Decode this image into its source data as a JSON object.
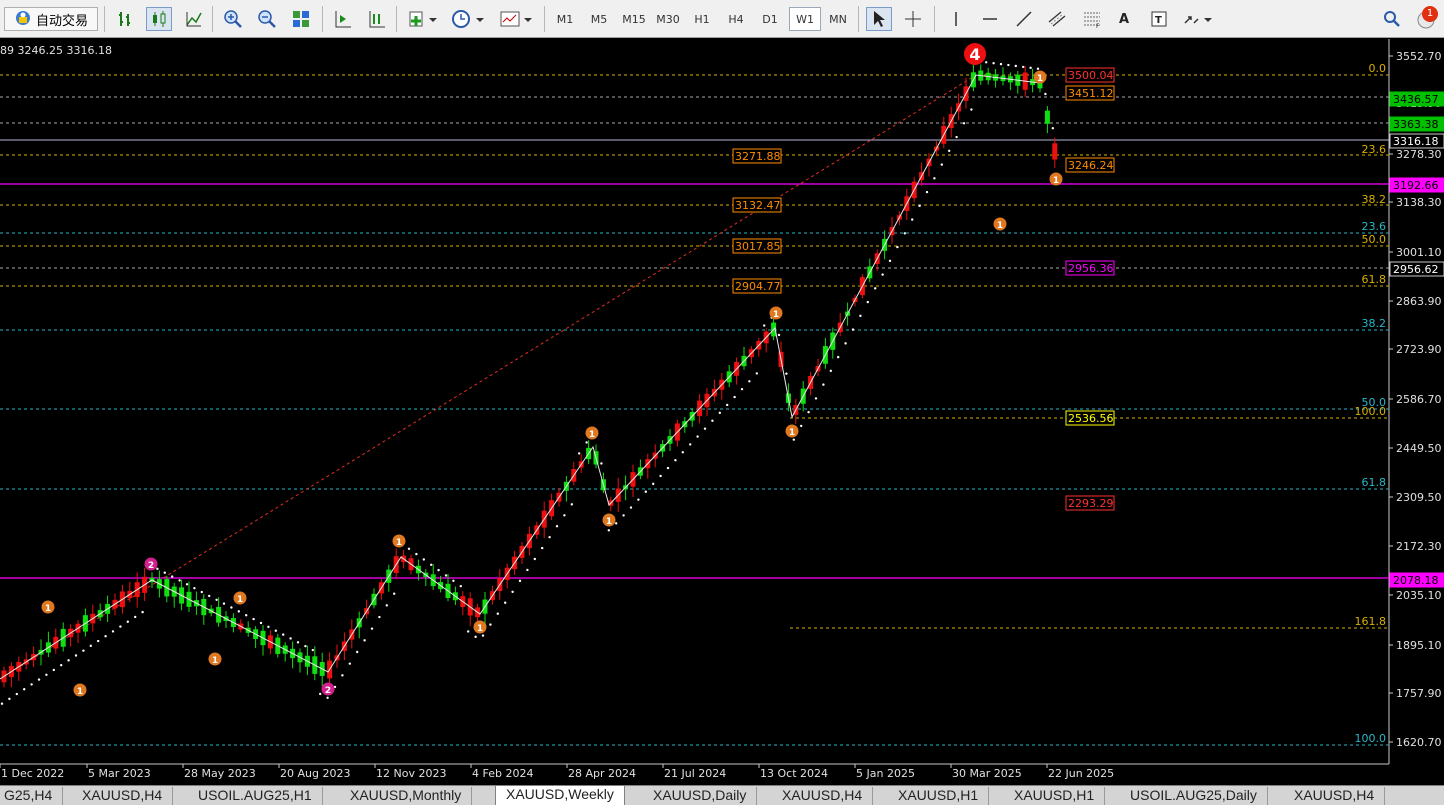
{
  "toolbar": {
    "autotrade_label": "自动交易",
    "timeframes": [
      "M1",
      "M5",
      "M15",
      "M30",
      "H1",
      "H4",
      "D1",
      "W1",
      "MN"
    ],
    "active_timeframe": "W1",
    "text_tool_label": "A"
  },
  "notification_count": "1",
  "chart": {
    "info": "89 3246.25 3316.18",
    "price_axis": [
      "3552.70",
      "3415.90",
      "3278.30",
      "3138.30",
      "3001.10",
      "2863.90",
      "2723.90",
      "2586.70",
      "2449.50",
      "2309.50",
      "2172.30",
      "2035.10",
      "1895.10",
      "1757.90",
      "1620.70"
    ],
    "price_tags": [
      {
        "text": "3436.57",
        "bg": "#00c000",
        "fg": "#000"
      },
      {
        "text": "3363.38",
        "bg": "#00c000",
        "fg": "#000"
      },
      {
        "text": "3316.18",
        "bg": "#000",
        "fg": "#fff"
      },
      {
        "text": "3192.66",
        "bg": "#ff00ff",
        "fg": "#000"
      },
      {
        "text": "2956.62",
        "bg": "#000",
        "fg": "#fff"
      },
      {
        "text": "2078.18",
        "bg": "#ff00ff",
        "fg": "#000"
      }
    ],
    "time_axis": [
      "1 Dec 2022",
      "5 Mar 2023",
      "28 May 2023",
      "20 Aug 2023",
      "12 Nov 2023",
      "4 Feb 2024",
      "28 Apr 2024",
      "21 Jul 2024",
      "13 Oct 2024",
      "5 Jan 2025",
      "30 Mar 2025",
      "22 Jun 2025"
    ],
    "fib_labels": [
      {
        "text": "0.0",
        "color": "#d8b000"
      },
      {
        "text": "23.6",
        "color": "#d8b000"
      },
      {
        "text": "38.2",
        "color": "#d8b000"
      },
      {
        "text": "23.6",
        "color": "#29b6c8"
      },
      {
        "text": "50.0",
        "color": "#d8b000"
      },
      {
        "text": "61.8",
        "color": "#d8b000"
      },
      {
        "text": "38.2",
        "color": "#29b6c8"
      },
      {
        "text": "50.0",
        "color": "#29b6c8"
      },
      {
        "text": "100.0",
        "color": "#d8b000"
      },
      {
        "text": "61.8",
        "color": "#29b6c8"
      },
      {
        "text": "161.8",
        "color": "#d8b000"
      },
      {
        "text": "100.0",
        "color": "#29b6c8"
      }
    ],
    "level_boxes": [
      {
        "text": "3500.04",
        "color": "#ff3030"
      },
      {
        "text": "3451.12",
        "color": "#ff8c00"
      },
      {
        "text": "3271.88",
        "color": "#ff8c00"
      },
      {
        "text": "3246.24",
        "color": "#ff8c00"
      },
      {
        "text": "3132.47",
        "color": "#ff8c00"
      },
      {
        "text": "3017.85",
        "color": "#ff8c00"
      },
      {
        "text": "2956.36",
        "color": "#ff00ff"
      },
      {
        "text": "2904.77",
        "color": "#ff8c00"
      },
      {
        "text": "2536.56",
        "color": "#ffff00"
      },
      {
        "text": "2293.29",
        "color": "#ff3030"
      }
    ],
    "wave_labels": [
      "4",
      "1",
      "1",
      "1",
      "1",
      "1",
      "1",
      "1",
      "1",
      "1",
      "1",
      "1",
      "1",
      "1",
      "2",
      "2"
    ]
  },
  "tabs": [
    {
      "label": "G25,H4"
    },
    {
      "label": "XAUUSD,H4"
    },
    {
      "label": "USOIL.AUG25,H1"
    },
    {
      "label": "XAUUSD,Monthly"
    },
    {
      "label": "XAUUSD,Weekly",
      "active": true
    },
    {
      "label": "XAUUSD,Daily"
    },
    {
      "label": "XAUUSD,H4"
    },
    {
      "label": "XAUUSD,H1"
    },
    {
      "label": "XAUUSD,H1"
    },
    {
      "label": "USOIL.AUG25,Daily"
    },
    {
      "label": "XAUUSD,H4"
    }
  ]
}
